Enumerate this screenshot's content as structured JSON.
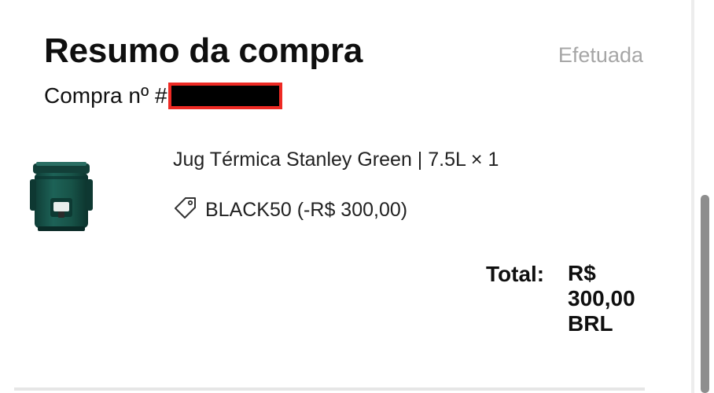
{
  "header": {
    "title": "Resumo da compra",
    "status": "Efetuada",
    "order_label": "Compra nº #"
  },
  "items": [
    {
      "name": "Jug Térmica Stanley Green | 7.5L × 1",
      "coupon": "BLACK50 (-R$ 300,00)",
      "image_icon": "green-thermal-jug"
    }
  ],
  "total": {
    "label": "Total:",
    "value": "R$ 300,00 BRL"
  },
  "colors": {
    "redaction_border": "#ee2a24",
    "redaction_fill": "#000000",
    "product_green": "#17524a",
    "status_gray": "#a6a6a6"
  }
}
